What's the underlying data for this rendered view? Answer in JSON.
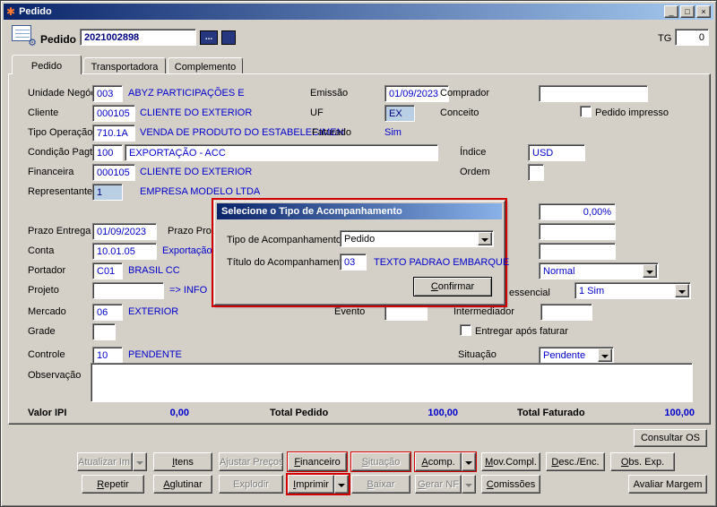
{
  "colors": {
    "titlebar_start": "#0a246a",
    "titlebar_end": "#a6caf0",
    "window_bg": "#d4d0c8",
    "value_text_blue": "#0000cc",
    "locked_field_bg": "#b9cfe4",
    "annotation_red": "#d40000"
  },
  "window": {
    "title": "Pedido",
    "controls": {
      "minimize": "_",
      "maximize": "□",
      "close": "×"
    }
  },
  "header": {
    "pedido_label": "Pedido",
    "numero": "2021002898",
    "ellipsis_label": "...",
    "tg_label": "TG",
    "tg_value": "0"
  },
  "tabs": {
    "pedido": "Pedido",
    "transportadora": "Transportadora",
    "complemento": "Complemento"
  },
  "form": {
    "unidade_negocio": {
      "label": "Unidade Negócio",
      "code": "003",
      "desc": "ABYZ PARTICIPAÇÕES E"
    },
    "emissao": {
      "label": "Emissão",
      "value": "01/09/2023"
    },
    "comprador": {
      "label": "Comprador",
      "value": ""
    },
    "cliente": {
      "label": "Cliente",
      "code": "000105",
      "desc": "CLIENTE DO EXTERIOR"
    },
    "uf": {
      "label": "UF",
      "value": "EX"
    },
    "conceito": {
      "label": "Conceito"
    },
    "pedido_impresso": {
      "label": "Pedido impresso",
      "checked": false
    },
    "tipo_operacao": {
      "label": "Tipo Operação",
      "code": "710.1A",
      "desc": "VENDA DE PRODUTO DO ESTABELECIMEN'"
    },
    "faturado": {
      "label": "Faturado",
      "value": "Sim"
    },
    "condicao_pagto": {
      "label": "Condição Pagto.",
      "code": "100",
      "desc": "EXPORTAÇÃO - ACC"
    },
    "indice": {
      "label": "Índice",
      "value": "USD"
    },
    "financeira": {
      "label": "Financeira",
      "code": "000105",
      "desc": "CLIENTE DO EXTERIOR"
    },
    "ordem": {
      "label": "Ordem",
      "value": ""
    },
    "representante": {
      "label": "Representante",
      "code": "1",
      "desc": "EMPRESA MODELO LTDA"
    },
    "percentual": {
      "value": "0,00%"
    },
    "prazo_entrega": {
      "label": "Prazo Entrega",
      "value": "01/09/2023"
    },
    "prazo_pro": {
      "label": "Prazo Pro"
    },
    "conta": {
      "label": "Conta",
      "code": "10.01.05",
      "desc": "Exportação"
    },
    "portador": {
      "label": "Portador",
      "code": "C01",
      "desc": "BRASIL CC"
    },
    "combo_normal": {
      "value": "Normal"
    },
    "projeto": {
      "label": "Projeto",
      "value": "",
      "desc": "=> INFO"
    },
    "essencial": {
      "label": "essencial",
      "value": "1 Sim"
    },
    "mercado": {
      "label": "Mercado",
      "code": "06",
      "desc": "EXTERIOR"
    },
    "evento": {
      "label": "Evento",
      "value": ""
    },
    "intermediador": {
      "label": "Intermediador",
      "value": ""
    },
    "grade": {
      "label": "Grade",
      "value": ""
    },
    "entregar_apos_faturar": {
      "label": "Entregar após faturar",
      "checked": false
    },
    "controle": {
      "label": "Controle",
      "code": "10",
      "desc": "PENDENTE"
    },
    "situacao": {
      "label": "Situação",
      "value": "Pendente"
    },
    "observacao": {
      "label": "Observação",
      "value": ""
    }
  },
  "totals": {
    "valor_ipi_label": "Valor IPI",
    "valor_ipi": "0,00",
    "total_pedido_label": "Total Pedido",
    "total_pedido": "100,00",
    "total_faturado_label": "Total Faturado",
    "total_faturado": "100,00"
  },
  "dialog": {
    "title": "Selecione o Tipo de Acompanhamento",
    "tipo_label": "Tipo de Acompanhamento",
    "tipo_value": "Pedido",
    "titulo_label": "Título do Acompanhamento",
    "titulo_code": "03",
    "titulo_desc": "TEXTO PADRAO EMBARQUE",
    "confirmar": "Confirmar"
  },
  "actions": {
    "consultar_os": "Consultar OS",
    "atualizar_imp": "Atualizar Imp",
    "itens": "Itens",
    "ajustar_precos": "Ajustar Preços",
    "financeiro": "Financeiro",
    "situacao": "Situação",
    "acomp": "Acomp.",
    "mov_compl": "Mov.Compl.",
    "desc_enc": "Desc./Enc.",
    "obs_exp": "Obs. Exp.",
    "repetir": "Repetir",
    "aglutinar": "Aglutinar",
    "explodir": "Explodir",
    "imprimir": "Imprimir",
    "baixar": "Baixar",
    "gerar_nf": "Gerar NF",
    "comissoes": "Comissões",
    "avaliar_margem": "Avaliar Margem"
  }
}
